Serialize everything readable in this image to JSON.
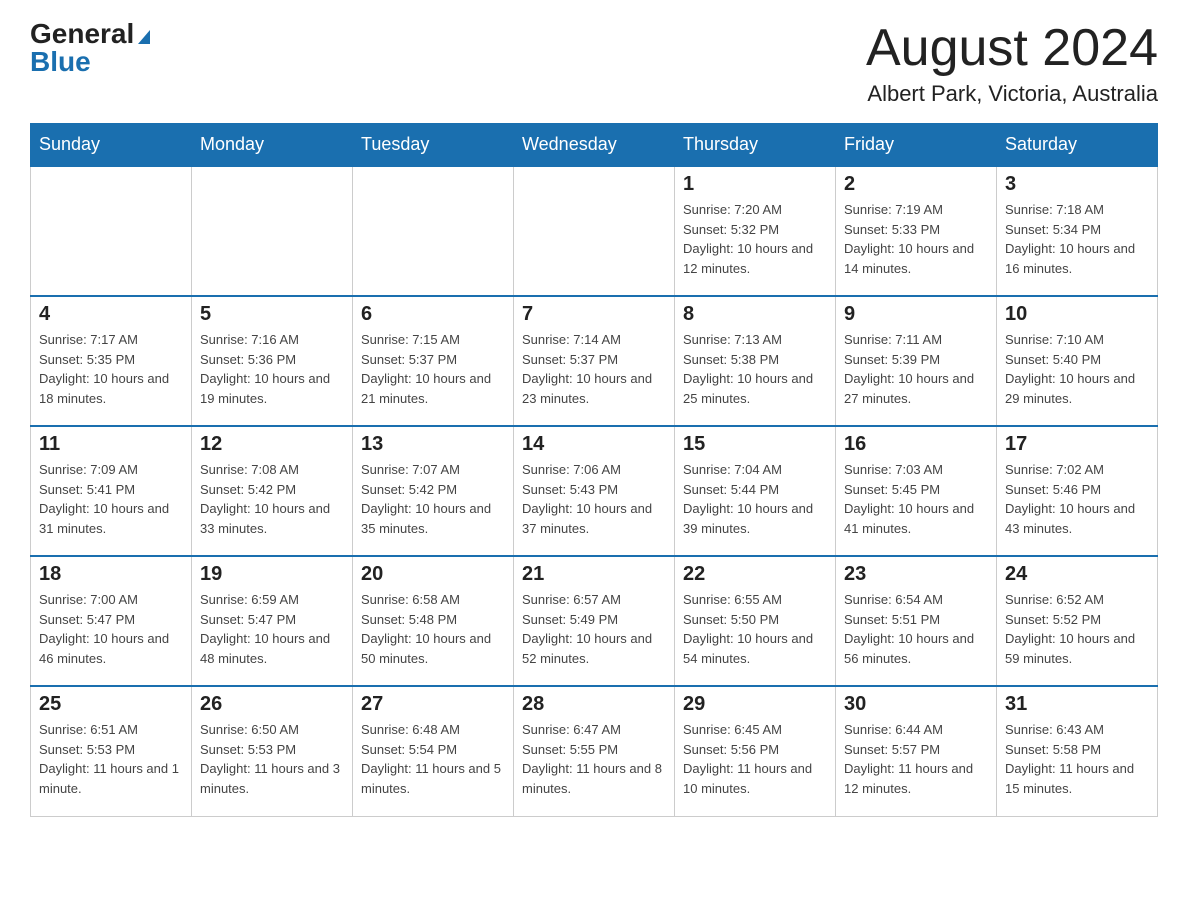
{
  "header": {
    "logo_general": "General",
    "logo_blue": "Blue",
    "month_title": "August 2024",
    "location": "Albert Park, Victoria, Australia"
  },
  "days_of_week": [
    "Sunday",
    "Monday",
    "Tuesday",
    "Wednesday",
    "Thursday",
    "Friday",
    "Saturday"
  ],
  "weeks": [
    [
      {
        "day": "",
        "info": ""
      },
      {
        "day": "",
        "info": ""
      },
      {
        "day": "",
        "info": ""
      },
      {
        "day": "",
        "info": ""
      },
      {
        "day": "1",
        "info": "Sunrise: 7:20 AM\nSunset: 5:32 PM\nDaylight: 10 hours and 12 minutes."
      },
      {
        "day": "2",
        "info": "Sunrise: 7:19 AM\nSunset: 5:33 PM\nDaylight: 10 hours and 14 minutes."
      },
      {
        "day": "3",
        "info": "Sunrise: 7:18 AM\nSunset: 5:34 PM\nDaylight: 10 hours and 16 minutes."
      }
    ],
    [
      {
        "day": "4",
        "info": "Sunrise: 7:17 AM\nSunset: 5:35 PM\nDaylight: 10 hours and 18 minutes."
      },
      {
        "day": "5",
        "info": "Sunrise: 7:16 AM\nSunset: 5:36 PM\nDaylight: 10 hours and 19 minutes."
      },
      {
        "day": "6",
        "info": "Sunrise: 7:15 AM\nSunset: 5:37 PM\nDaylight: 10 hours and 21 minutes."
      },
      {
        "day": "7",
        "info": "Sunrise: 7:14 AM\nSunset: 5:37 PM\nDaylight: 10 hours and 23 minutes."
      },
      {
        "day": "8",
        "info": "Sunrise: 7:13 AM\nSunset: 5:38 PM\nDaylight: 10 hours and 25 minutes."
      },
      {
        "day": "9",
        "info": "Sunrise: 7:11 AM\nSunset: 5:39 PM\nDaylight: 10 hours and 27 minutes."
      },
      {
        "day": "10",
        "info": "Sunrise: 7:10 AM\nSunset: 5:40 PM\nDaylight: 10 hours and 29 minutes."
      }
    ],
    [
      {
        "day": "11",
        "info": "Sunrise: 7:09 AM\nSunset: 5:41 PM\nDaylight: 10 hours and 31 minutes."
      },
      {
        "day": "12",
        "info": "Sunrise: 7:08 AM\nSunset: 5:42 PM\nDaylight: 10 hours and 33 minutes."
      },
      {
        "day": "13",
        "info": "Sunrise: 7:07 AM\nSunset: 5:42 PM\nDaylight: 10 hours and 35 minutes."
      },
      {
        "day": "14",
        "info": "Sunrise: 7:06 AM\nSunset: 5:43 PM\nDaylight: 10 hours and 37 minutes."
      },
      {
        "day": "15",
        "info": "Sunrise: 7:04 AM\nSunset: 5:44 PM\nDaylight: 10 hours and 39 minutes."
      },
      {
        "day": "16",
        "info": "Sunrise: 7:03 AM\nSunset: 5:45 PM\nDaylight: 10 hours and 41 minutes."
      },
      {
        "day": "17",
        "info": "Sunrise: 7:02 AM\nSunset: 5:46 PM\nDaylight: 10 hours and 43 minutes."
      }
    ],
    [
      {
        "day": "18",
        "info": "Sunrise: 7:00 AM\nSunset: 5:47 PM\nDaylight: 10 hours and 46 minutes."
      },
      {
        "day": "19",
        "info": "Sunrise: 6:59 AM\nSunset: 5:47 PM\nDaylight: 10 hours and 48 minutes."
      },
      {
        "day": "20",
        "info": "Sunrise: 6:58 AM\nSunset: 5:48 PM\nDaylight: 10 hours and 50 minutes."
      },
      {
        "day": "21",
        "info": "Sunrise: 6:57 AM\nSunset: 5:49 PM\nDaylight: 10 hours and 52 minutes."
      },
      {
        "day": "22",
        "info": "Sunrise: 6:55 AM\nSunset: 5:50 PM\nDaylight: 10 hours and 54 minutes."
      },
      {
        "day": "23",
        "info": "Sunrise: 6:54 AM\nSunset: 5:51 PM\nDaylight: 10 hours and 56 minutes."
      },
      {
        "day": "24",
        "info": "Sunrise: 6:52 AM\nSunset: 5:52 PM\nDaylight: 10 hours and 59 minutes."
      }
    ],
    [
      {
        "day": "25",
        "info": "Sunrise: 6:51 AM\nSunset: 5:53 PM\nDaylight: 11 hours and 1 minute."
      },
      {
        "day": "26",
        "info": "Sunrise: 6:50 AM\nSunset: 5:53 PM\nDaylight: 11 hours and 3 minutes."
      },
      {
        "day": "27",
        "info": "Sunrise: 6:48 AM\nSunset: 5:54 PM\nDaylight: 11 hours and 5 minutes."
      },
      {
        "day": "28",
        "info": "Sunrise: 6:47 AM\nSunset: 5:55 PM\nDaylight: 11 hours and 8 minutes."
      },
      {
        "day": "29",
        "info": "Sunrise: 6:45 AM\nSunset: 5:56 PM\nDaylight: 11 hours and 10 minutes."
      },
      {
        "day": "30",
        "info": "Sunrise: 6:44 AM\nSunset: 5:57 PM\nDaylight: 11 hours and 12 minutes."
      },
      {
        "day": "31",
        "info": "Sunrise: 6:43 AM\nSunset: 5:58 PM\nDaylight: 11 hours and 15 minutes."
      }
    ]
  ]
}
